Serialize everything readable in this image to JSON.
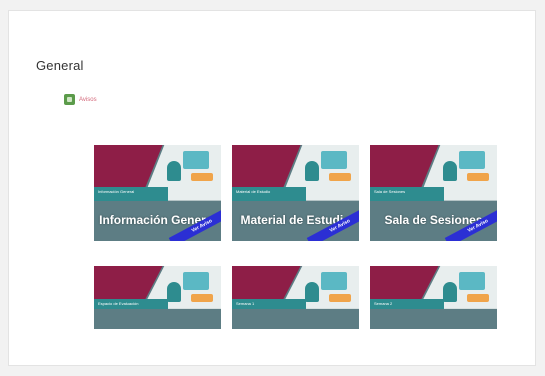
{
  "section": {
    "title": "General"
  },
  "avisos": {
    "label": "Avisos"
  },
  "tiles": [
    {
      "band": "Información General",
      "title": "Información General",
      "ribbon": "Ver Aviso"
    },
    {
      "band": "Material de Estudio",
      "title": "Material de Estudio",
      "ribbon": "Ver Aviso"
    },
    {
      "band": "Sala de Sesiones",
      "title": "Sala de Sesiones",
      "ribbon": "Ver Aviso"
    },
    {
      "band": "Espacio de Evaluación"
    },
    {
      "band": "Semana 1"
    },
    {
      "band": "Semana 2"
    }
  ],
  "colors": {
    "maroon": "#8e1e47",
    "teal": "#2e8c8f",
    "slate": "#5d7d84",
    "ribbon": "#2b2fd4"
  }
}
